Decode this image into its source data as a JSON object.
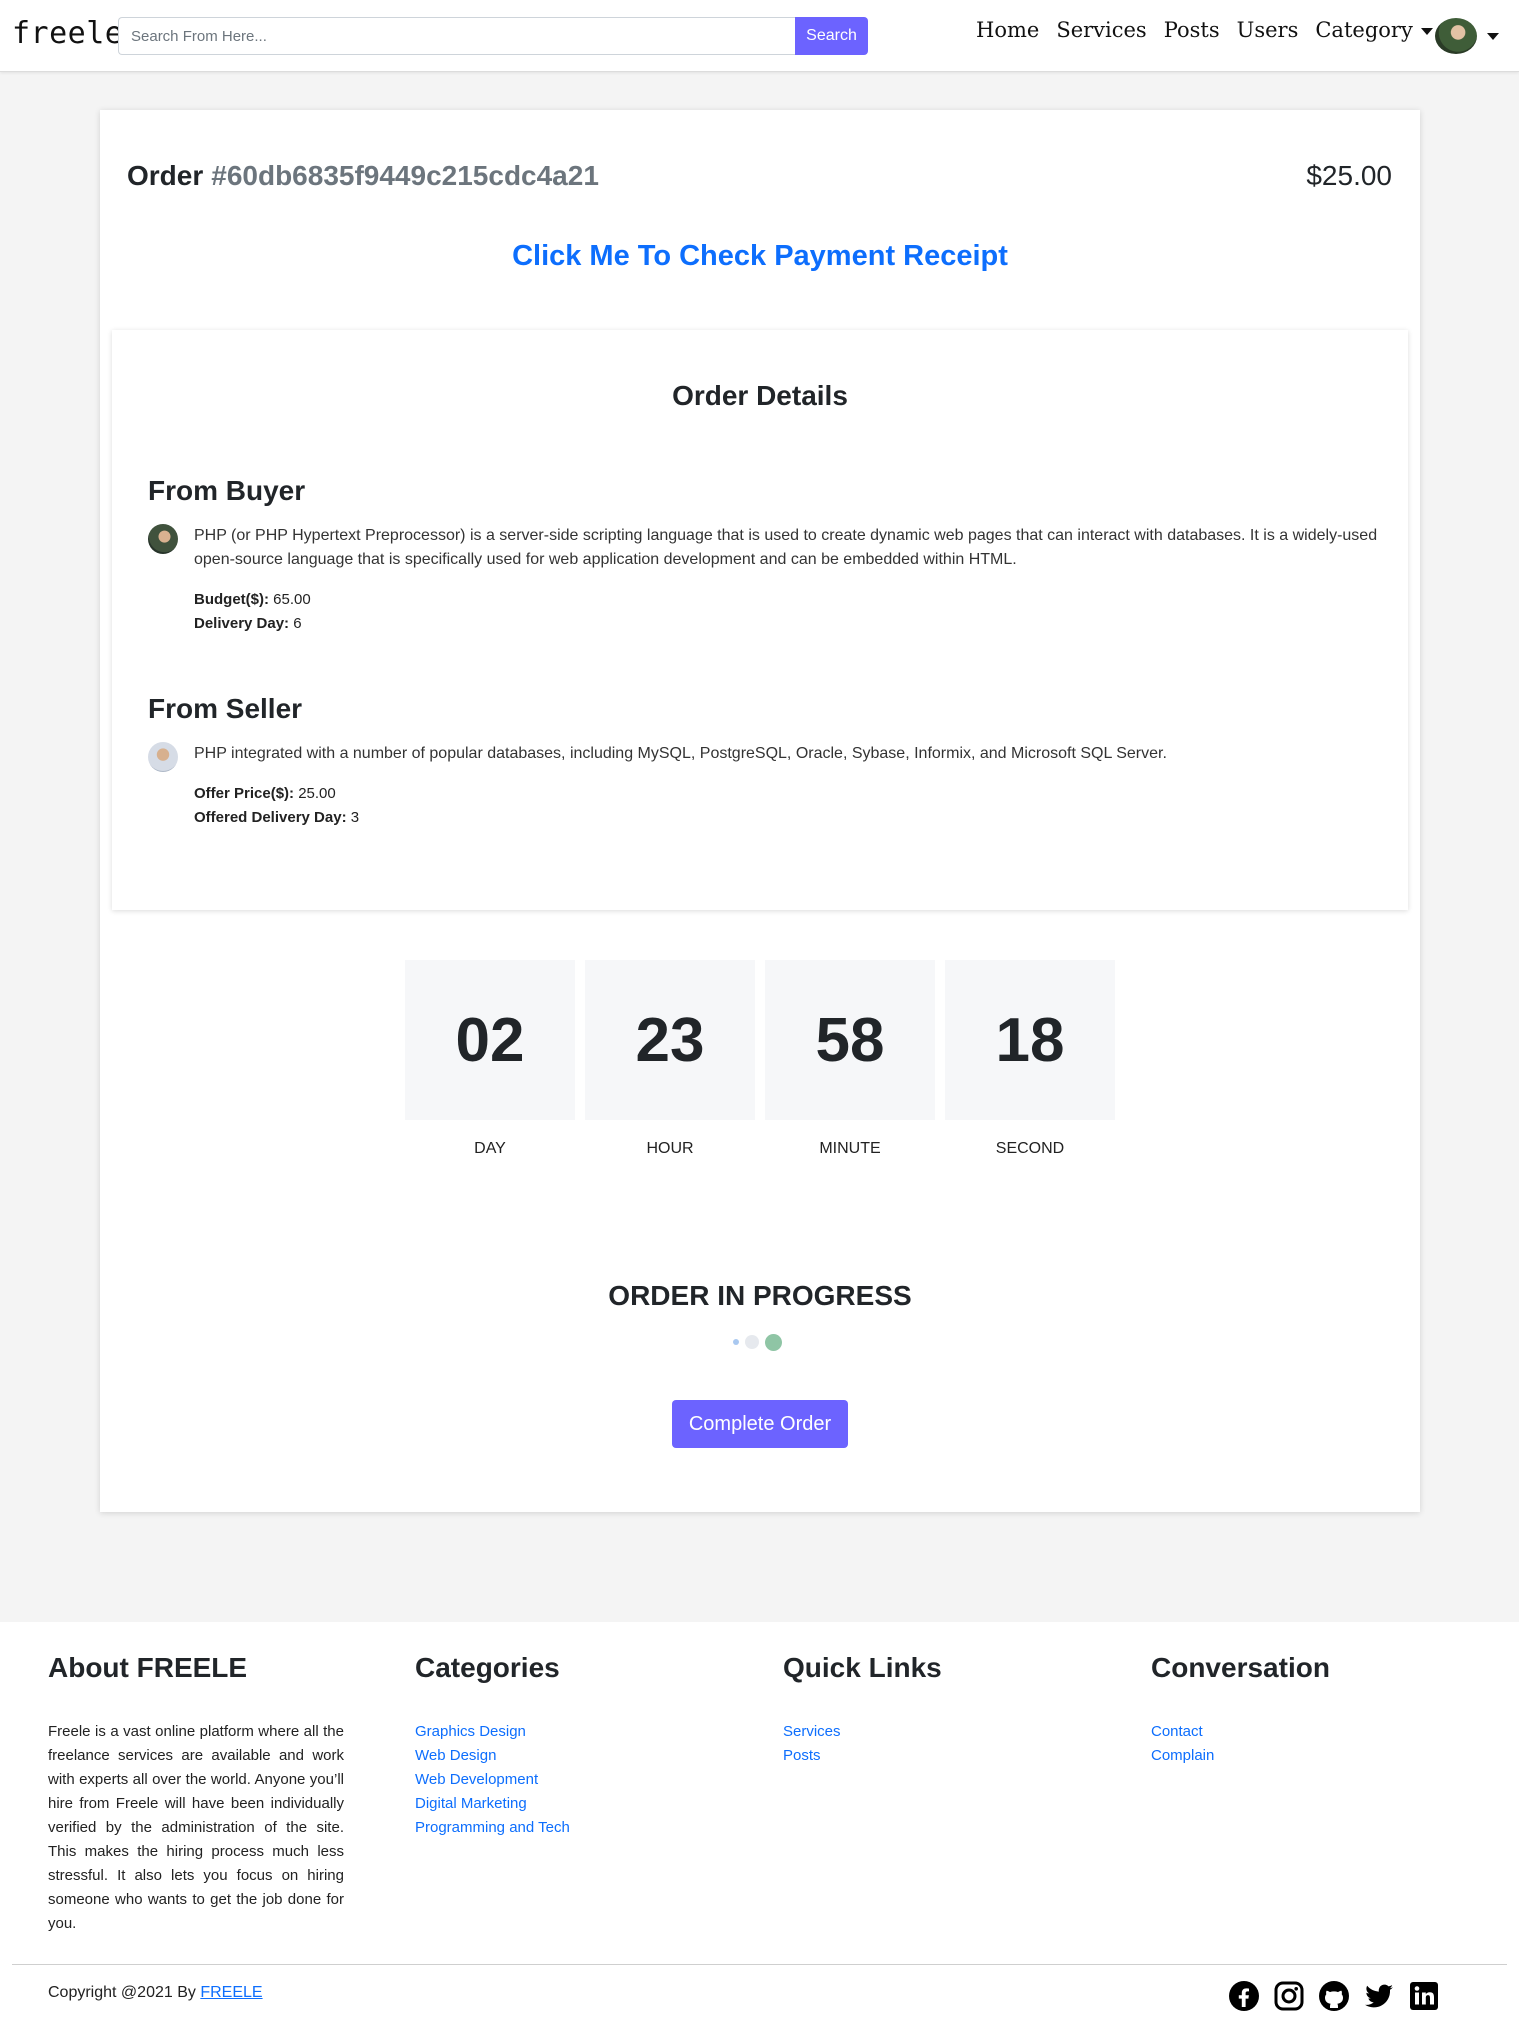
{
  "navbar": {
    "brand": "freele",
    "search_placeholder": "Search From Here...",
    "search_button": "Search",
    "links": [
      "Home",
      "Services",
      "Posts",
      "Users",
      "Category"
    ]
  },
  "order": {
    "label": "Order",
    "id": "#60db6835f9449c215cdc4a21",
    "price": "$25.00",
    "receipt_link": "Click Me To Check Payment Receipt"
  },
  "details": {
    "title": "Order Details",
    "buyer": {
      "heading": "From Buyer",
      "text": "PHP (or PHP Hypertext Preprocessor) is a server-side scripting language that is used to create dynamic web pages that can interact with databases. It is a widely-used open-source language that is specifically used for web application development and can be embedded within HTML.",
      "budget_label": "Budget($):",
      "budget_value": "65.00",
      "delivery_label": "Delivery Day:",
      "delivery_value": "6"
    },
    "seller": {
      "heading": "From Seller",
      "text": "PHP integrated with a number of popular databases, including MySQL, PostgreSQL, Oracle, Sybase, Informix, and Microsoft SQL Server.",
      "offer_label": "Offer Price($):",
      "offer_value": "25.00",
      "delivery_label": "Offered Delivery Day:",
      "delivery_value": "3"
    }
  },
  "countdown": [
    {
      "value": "02",
      "label": "DAY"
    },
    {
      "value": "23",
      "label": "HOUR"
    },
    {
      "value": "58",
      "label": "MINUTE"
    },
    {
      "value": "18",
      "label": "SECOND"
    }
  ],
  "status": {
    "title": "ORDER IN PROGRESS",
    "dot_colors": [
      "#a9c8f0",
      "#e6e9ee",
      "#8fc5a5"
    ],
    "complete_button": "Complete Order"
  },
  "footer": {
    "about": {
      "heading": "About FREELE",
      "text": "Freele is a vast online platform where all the freelance services are available and work with experts all over the world. Anyone you’ll hire from Freele will have been individually verified by the administration of the site. This makes the hiring process much less stressful. It also lets you focus on hiring someone who wants to get the job done for you."
    },
    "categories": {
      "heading": "Categories",
      "links": [
        "Graphics Design",
        "Web Design",
        "Web Development",
        "Digital Marketing",
        "Programming and Tech"
      ]
    },
    "quick_links": {
      "heading": "Quick Links",
      "links": [
        "Services",
        "Posts"
      ]
    },
    "conversation": {
      "heading": "Conversation",
      "links": [
        "Contact",
        "Complain"
      ]
    },
    "copyright_prefix": "Copyright @2021 By",
    "copyright_link": "FREELE",
    "social_icons": [
      "facebook-icon",
      "instagram-icon",
      "github-icon",
      "twitter-icon",
      "linkedin-icon"
    ]
  }
}
